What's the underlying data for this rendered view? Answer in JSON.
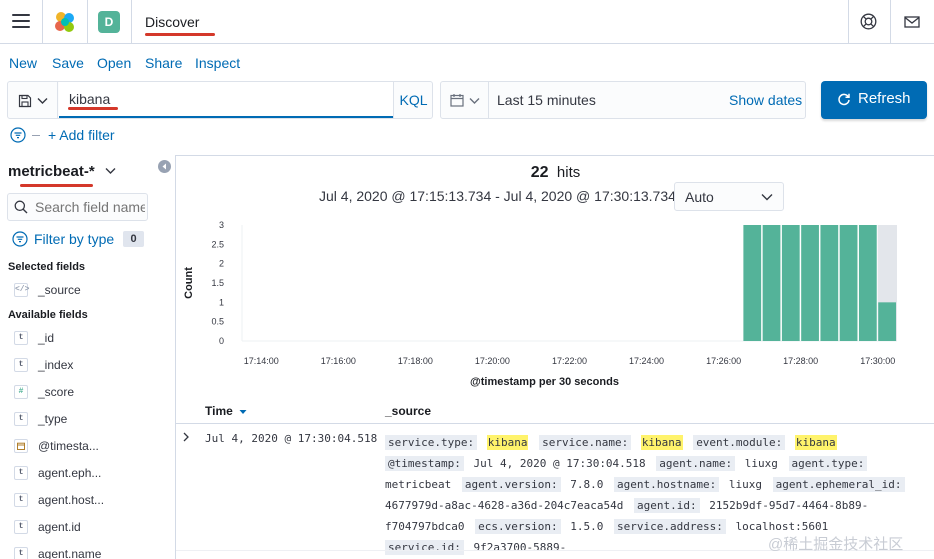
{
  "header": {
    "space_initial": "D",
    "app_title": "Discover"
  },
  "toolbar": {
    "new": "New",
    "save": "Save",
    "open": "Open",
    "share": "Share",
    "inspect": "Inspect"
  },
  "query": {
    "value": "kibana",
    "language": "KQL"
  },
  "time": {
    "range_label": "Last 15 minutes",
    "show_dates": "Show dates",
    "refresh": "Refresh"
  },
  "filters": {
    "add_filter": "+ Add filter"
  },
  "sidebar": {
    "index_pattern": "metricbeat-*",
    "search_placeholder": "Search field names",
    "filter_by_type": "Filter by type",
    "filter_count": "0",
    "selected_title": "Selected fields",
    "selected_fields": [
      {
        "name": "_source",
        "type": "source"
      }
    ],
    "available_title": "Available fields",
    "available_fields": [
      {
        "name": "_id",
        "type": "t"
      },
      {
        "name": "_index",
        "type": "t"
      },
      {
        "name": "_score",
        "type": "#"
      },
      {
        "name": "_type",
        "type": "t"
      },
      {
        "name": "@timesta...",
        "type": "date"
      },
      {
        "name": "agent.eph...",
        "type": "t"
      },
      {
        "name": "agent.host...",
        "type": "t"
      },
      {
        "name": "agent.id",
        "type": "t"
      },
      {
        "name": "agent.name",
        "type": "t"
      }
    ]
  },
  "results": {
    "hits_count": "22",
    "hits_label": "hits",
    "time_range": "Jul 4, 2020 @ 17:15:13.734 - Jul 4, 2020 @ 17:30:13.734 —",
    "interval": "Auto"
  },
  "chart_data": {
    "type": "bar",
    "xlabel": "@timestamp per 30 seconds",
    "ylabel": "Count",
    "ylim": [
      0,
      3
    ],
    "y_ticks": [
      "0",
      "0.5",
      "1",
      "1.5",
      "2",
      "2.5",
      "3"
    ],
    "x_tick_labels": [
      "17:14:00",
      "17:16:00",
      "17:18:00",
      "17:20:00",
      "17:22:00",
      "17:24:00",
      "17:26:00",
      "17:28:00",
      "17:30:00"
    ],
    "x_tick_minutes": [
      14,
      16,
      18,
      20,
      22,
      24,
      26,
      28,
      30
    ],
    "x_range_minutes": [
      13.5,
      30.5
    ],
    "bar_start_minutes": [
      26.5,
      27.0,
      27.5,
      28.0,
      28.5,
      29.0,
      29.5,
      30.0
    ],
    "bar_width_minutes": 0.5,
    "values": [
      3,
      3,
      3,
      3,
      3,
      3,
      3,
      1
    ],
    "color": "#54b399",
    "partial_bucket_start_minutes": 30.0
  },
  "table": {
    "col_time": "Time",
    "col_source": "_source",
    "rows": [
      {
        "time": "Jul 4, 2020 @ 17:30:04.518",
        "fields": [
          {
            "k": "service.type:",
            "v": "kibana",
            "hl": true
          },
          {
            "k": "service.name:",
            "v": "kibana",
            "hl": true
          },
          {
            "k": "event.module:",
            "v": "kibana",
            "hl": true
          },
          {
            "k": "@timestamp:",
            "v": "Jul 4, 2020 @ 17:30:04.518",
            "hl": false
          },
          {
            "k": "agent.name:",
            "v": "liuxg",
            "hl": false
          },
          {
            "k": "agent.type:",
            "v": "metricbeat",
            "hl": false
          },
          {
            "k": "agent.version:",
            "v": "7.8.0",
            "hl": false
          },
          {
            "k": "agent.hostname:",
            "v": "liuxg",
            "hl": false
          },
          {
            "k": "agent.ephemeral_id:",
            "v": "4677979d-a8ac-4628-a36d-204c7eaca54d",
            "hl": false
          },
          {
            "k": "agent.id:",
            "v": "2152b9df-95d7-4464-8b89-f704797bdca0",
            "hl": false
          },
          {
            "k": "ecs.version:",
            "v": "1.5.0",
            "hl": false
          },
          {
            "k": "service.address:",
            "v": "localhost:5601",
            "hl": false
          },
          {
            "k": "service.id:",
            "v": "9f2a3700-5889-",
            "hl": false
          }
        ]
      }
    ]
  },
  "watermark": "@稀土掘金技术社区"
}
